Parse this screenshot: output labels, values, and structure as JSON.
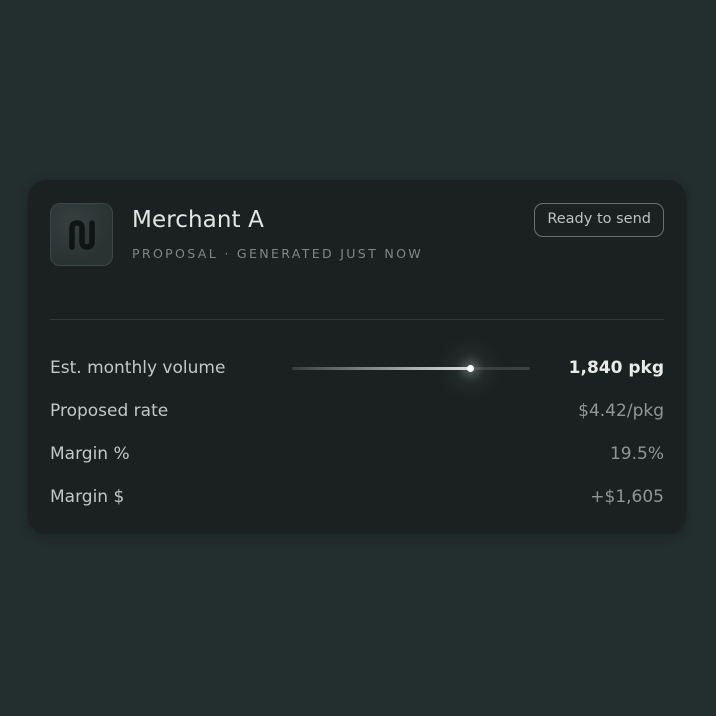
{
  "card": {
    "logo_icon": "merchant-logo-icon",
    "title": "Merchant A",
    "subtitle": "PROPOSAL · GENERATED JUST NOW",
    "status_badge": "Ready to send"
  },
  "metrics": [
    {
      "label": "Est. monthly volume",
      "value": "1,840 pkg",
      "slider_level": 0.75
    },
    {
      "label": "Proposed rate",
      "value": "$4.42/pkg"
    },
    {
      "label": "Margin %",
      "value": "19.5%"
    },
    {
      "label": "Margin $",
      "value": "+$1,605"
    }
  ],
  "colors": {
    "background": "#232e2f",
    "card": "#1b2121",
    "text_primary": "#e3e6e3",
    "text_muted": "#7f8886"
  }
}
